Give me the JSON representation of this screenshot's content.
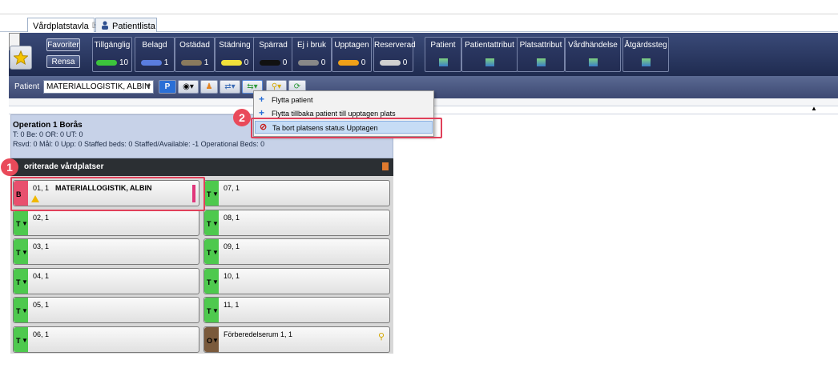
{
  "tabs": [
    {
      "label": "Vårdplatstavla",
      "close": "☒"
    },
    {
      "label": "Patientlista"
    }
  ],
  "toolbar": {
    "favorites_label": "Favoriter",
    "clear_label": "Rensa"
  },
  "status_cells": [
    {
      "label": "Tillgänglig",
      "count": "10",
      "color": "#3cc43c"
    },
    {
      "label": "Belagd",
      "count": "1",
      "color": "#5a7de0"
    },
    {
      "label": "Ostädad",
      "count": "1",
      "color": "#8a7a5e"
    },
    {
      "label": "Städning",
      "count": "0",
      "color": "#f2e23a"
    },
    {
      "label": "Spärrad",
      "count": "0",
      "color": "#111111"
    },
    {
      "label": "Ej i bruk",
      "count": "0",
      "color": "#888888"
    },
    {
      "label": "Upptagen",
      "count": "0",
      "color": "#f0a018"
    },
    {
      "label": "Reserverad",
      "count": "0",
      "color": "#d0d0d0"
    },
    {
      "label": "Patient"
    },
    {
      "label": "Patientattribut"
    },
    {
      "label": "Platsattribut"
    },
    {
      "label": "Vårdhändelse"
    },
    {
      "label": "Åtgärdssteg"
    }
  ],
  "patient_bar": {
    "label": "Patient",
    "selected_patient": "MATERIALLOGISTIK, ALBIN"
  },
  "department": {
    "title": "Operation 1 Borås",
    "line1": "T: 0 Be: 0 OR: 0 UT: 0",
    "line2": "Rsvd: 0 Mål: 0 Upp: 0 Staffed beds: 0 Staffed/Available: -1 Operational Beds: 0"
  },
  "group": {
    "title": "oriterade vårdplatser"
  },
  "beds": [
    {
      "id": "01, 1",
      "patient": "MATERIALLOGISTIK, ALBIN",
      "status": "B"
    },
    {
      "id": "07, 1",
      "status": "T"
    },
    {
      "id": "02, 1",
      "status": "T"
    },
    {
      "id": "08, 1",
      "status": "T"
    },
    {
      "id": "03, 1",
      "status": "T"
    },
    {
      "id": "09, 1",
      "status": "T"
    },
    {
      "id": "04, 1",
      "status": "T"
    },
    {
      "id": "10, 1",
      "status": "T"
    },
    {
      "id": "05, 1",
      "status": "T"
    },
    {
      "id": "11, 1",
      "status": "T"
    },
    {
      "id": "06, 1",
      "status": "T"
    },
    {
      "id": "Förberedelserum 1, 1",
      "status": "O"
    }
  ],
  "context_menu": {
    "items": [
      {
        "label": "Flytta patient",
        "icon": "plus-icon"
      },
      {
        "label": "Flytta tillbaka patient till upptagen plats",
        "icon": "plus-icon"
      },
      {
        "label": "Ta bort platsens status Upptagen",
        "icon": "prohibit-icon"
      }
    ]
  },
  "callouts": [
    "1",
    "2"
  ]
}
